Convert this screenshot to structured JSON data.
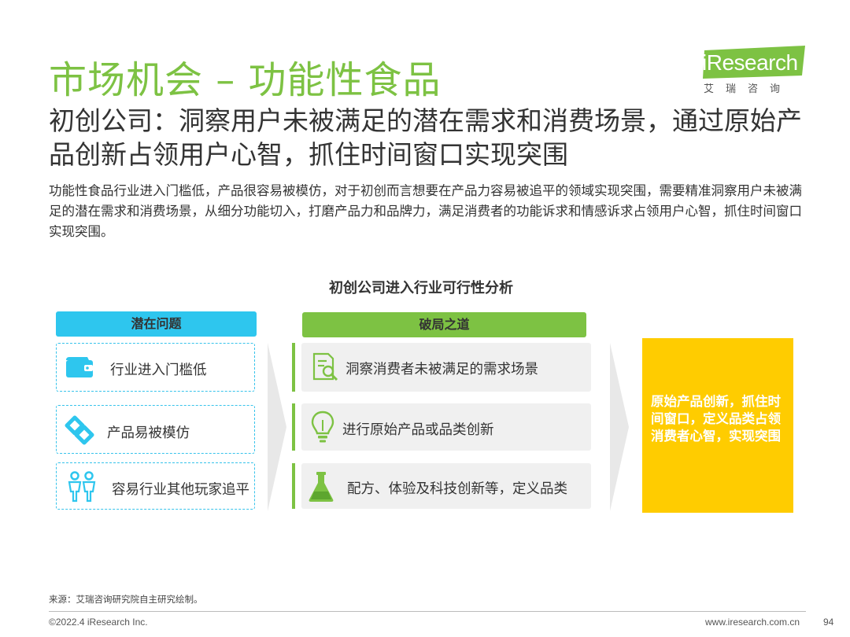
{
  "header": {
    "title": "市场机会 – 功能性食品",
    "subtitle": "初创公司：洞察用户未被满足的潜在需求和消费场景，通过原始产品创新占领用户心智，抓住时间窗口实现突围",
    "description": "功能性食品行业进入门槛低，产品很容易被模仿，对于初创而言想要在产品力容易被追平的领域实现突围，需要精准洞察用户未被满足的潜在需求和消费场景，从细分功能切入，打磨产品力和品牌力，满足消费者的功能诉求和情感诉求占领用户心智，抓住时间窗口实现突围。"
  },
  "logo": {
    "text": "iResearch",
    "sub": "艾瑞咨询",
    "color": "#7DC243"
  },
  "diagram": {
    "title": "初创公司进入行业可行性分析",
    "problems_header": "潜在问题",
    "solutions_header": "破局之道",
    "problems": [
      {
        "label": "行业进入门槛低",
        "icon": "wallet-icon"
      },
      {
        "label": "产品易被模仿",
        "icon": "copy-link-icon"
      },
      {
        "label": "容易行业其他玩家追平",
        "icon": "people-icon"
      }
    ],
    "solutions": [
      {
        "label": "洞察消费者未被满足的需求场景",
        "icon": "document-search-icon"
      },
      {
        "label": "进行原始产品或品类创新",
        "icon": "lightbulb-icon"
      },
      {
        "label": "配方、体验及科技创新等，定义品类",
        "icon": "flask-icon"
      }
    ],
    "result": "原始产品创新，抓住时间窗口，定义品类占领消费者心智，实现突围"
  },
  "colors": {
    "green": "#7DC243",
    "cyan": "#2EC6EE",
    "yellow": "#FFCC00"
  },
  "footer": {
    "source": "来源：艾瑞咨询研究院自主研究绘制。",
    "copyright": "©2022.4 iResearch Inc.",
    "website": "www.iresearch.com.cn",
    "page": "94"
  }
}
